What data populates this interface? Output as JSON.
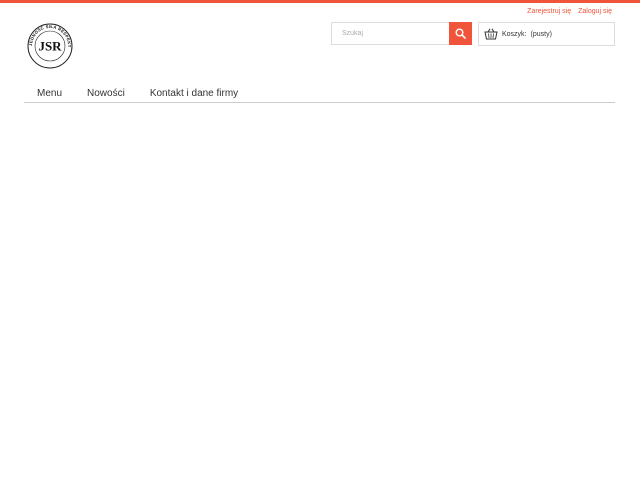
{
  "header": {
    "account_links": {
      "register": "Zarejestruj się",
      "login": "Zaloguj się"
    },
    "logo": {
      "initials": "JSR",
      "ring_text": "JEDNOŚĆ SIŁA RESPEKT"
    },
    "search": {
      "placeholder": "Szukaj",
      "value": "",
      "icon": "search-icon"
    },
    "cart": {
      "label": "Koszyk:",
      "status": "(pusty)",
      "icon": "basket-icon"
    }
  },
  "nav": {
    "items": [
      {
        "label": "Menu"
      },
      {
        "label": "Nowości"
      },
      {
        "label": "Kontakt i dane firmy"
      }
    ]
  },
  "colors": {
    "accent": "#f0543b",
    "border": "#dddddd",
    "text": "#333333"
  }
}
